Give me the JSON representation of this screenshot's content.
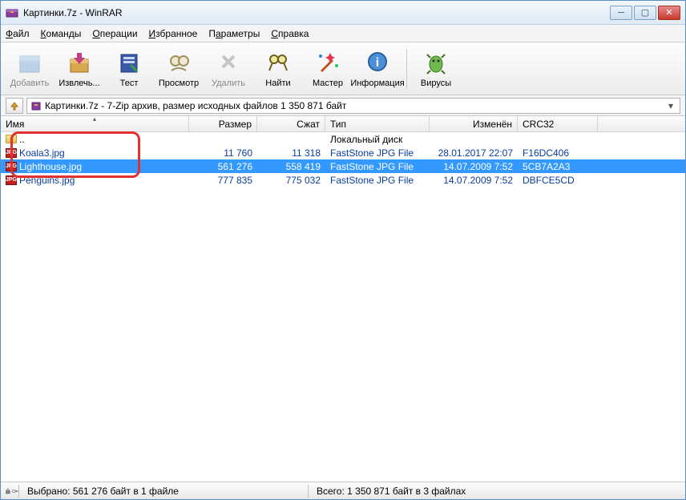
{
  "window": {
    "title": "Картинки.7z - WinRAR"
  },
  "menu": {
    "file": "Файл",
    "commands": "Команды",
    "ops": "Операции",
    "fav": "Избранное",
    "params": "Параметры",
    "help": "Справка"
  },
  "toolbar": {
    "add": "Добавить",
    "extract": "Извлечь...",
    "test": "Тест",
    "view": "Просмотр",
    "delete": "Удалить",
    "find": "Найти",
    "wizard": "Мастер",
    "info": "Информация",
    "virus": "Вирусы"
  },
  "pathbar": {
    "text": "Картинки.7z - 7-Zip архив, размер исходных файлов 1 350 871 байт"
  },
  "headers": {
    "name": "Имя",
    "size": "Размер",
    "packed": "Сжат",
    "type": "Тип",
    "modified": "Изменён",
    "crc": "CRC32"
  },
  "rows": {
    "parent": {
      "type": "Локальный диск"
    },
    "files": [
      {
        "name": "Koala3.jpg",
        "size": "11 760",
        "packed": "11 318",
        "type": "FastStone JPG File",
        "modified": "28.01.2017 22:07",
        "crc": "F16DC406",
        "selected": false
      },
      {
        "name": "Lighthouse.jpg",
        "size": "561 276",
        "packed": "558 419",
        "type": "FastStone JPG File",
        "modified": "14.07.2009 7:52",
        "crc": "5CB7A2A3",
        "selected": true
      },
      {
        "name": "Penguins.jpg",
        "size": "777 835",
        "packed": "775 032",
        "type": "FastStone JPG File",
        "modified": "14.07.2009 7:52",
        "crc": "DBFCE5CD",
        "selected": false
      }
    ]
  },
  "status": {
    "selected": "Выбрано: 561 276 байт в 1 файле",
    "total": "Всего: 1 350 871 байт в 3 файлах"
  }
}
